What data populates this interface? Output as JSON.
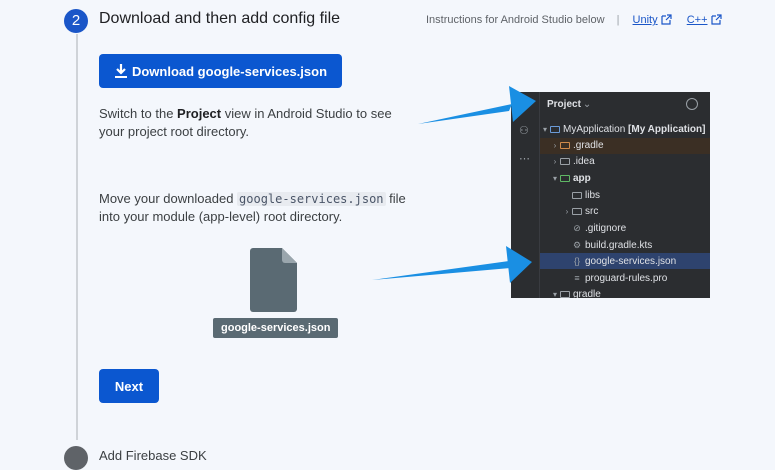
{
  "step": {
    "number": "2",
    "title": "Download and then add config file"
  },
  "instructions": {
    "text": "Instructions for Android Studio below",
    "separator": "|",
    "links": [
      {
        "label": "Unity"
      },
      {
        "label": "C++"
      }
    ]
  },
  "download_button": {
    "label": "Download google-services.json"
  },
  "paragraph1": {
    "before": "Switch to the ",
    "bold": "Project",
    "after": " view in Android Studio to see your project root directory."
  },
  "paragraph2": {
    "before": "Move your downloaded ",
    "code": "google-services.json",
    "after": " file into your module (app-level) root directory."
  },
  "file": {
    "label": "google-services.json"
  },
  "next_button": {
    "label": "Next"
  },
  "next_step": {
    "title": "Add Firebase SDK"
  },
  "ide": {
    "header": "Project",
    "tree": [
      {
        "label": "MyApplication",
        "suffix": "[My Application]"
      },
      {
        "label": ".gradle"
      },
      {
        "label": ".idea"
      },
      {
        "label": "app"
      },
      {
        "label": "libs"
      },
      {
        "label": "src"
      },
      {
        "label": ".gitignore"
      },
      {
        "label": "build.gradle.kts"
      },
      {
        "label": "google-services.json"
      },
      {
        "label": "proguard-rules.pro"
      },
      {
        "label": "gradle"
      }
    ]
  },
  "colors": {
    "accent": "#0b57d0",
    "arrow": "#1a8fe3",
    "background": "#f4f7fc",
    "ide_background": "#2b2d30"
  },
  "icons": [
    "download-icon",
    "external-link-icon",
    "file-icon",
    "folder-icon",
    "chevron-icon"
  ]
}
